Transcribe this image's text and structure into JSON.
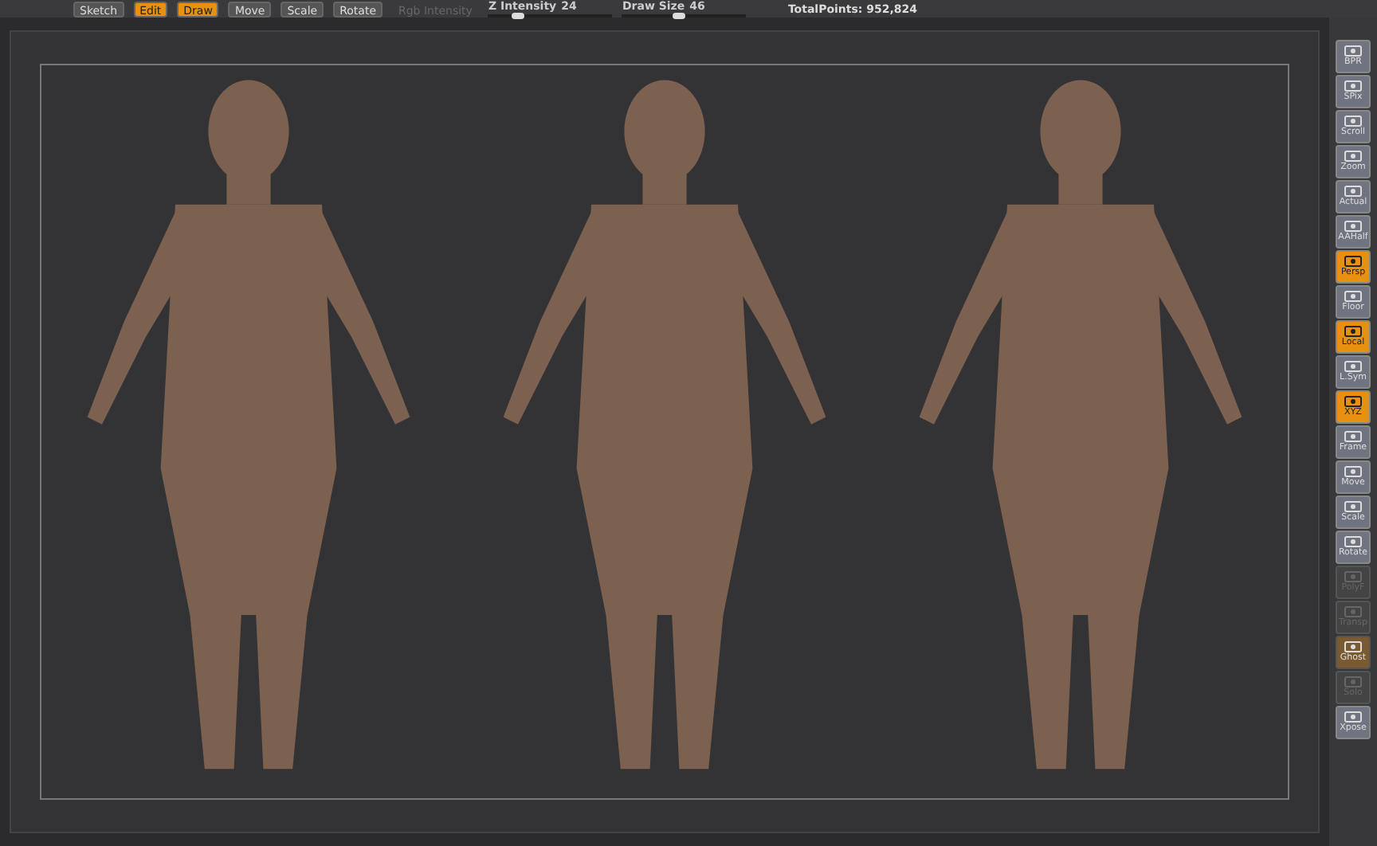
{
  "top_bar": {
    "buttons": [
      {
        "label": "Sketch",
        "selected": false,
        "disabled": false
      },
      {
        "label": "Edit",
        "selected": true,
        "disabled": false
      },
      {
        "label": "Draw",
        "selected": true,
        "disabled": false
      },
      {
        "label": "Move",
        "selected": false,
        "disabled": false
      },
      {
        "label": "Scale",
        "selected": false,
        "disabled": false
      },
      {
        "label": "Rotate",
        "selected": false,
        "disabled": false
      },
      {
        "label": "Rgb Intensity",
        "selected": false,
        "disabled": true
      }
    ],
    "sliders": [
      {
        "label": "Z Intensity",
        "reading": "24",
        "level": 0.24
      },
      {
        "label": "Draw Size",
        "reading": "46",
        "level": 0.46
      }
    ],
    "total_points": "TotalPoints: 952,824"
  },
  "right_toolbar": [
    {
      "label": "BPR",
      "on": false,
      "disabled": false
    },
    {
      "label": "SPix",
      "on": false,
      "disabled": false
    },
    {
      "label": "Scroll",
      "on": false,
      "disabled": false
    },
    {
      "label": "Zoom",
      "on": false,
      "disabled": false
    },
    {
      "label": "Actual",
      "on": false,
      "disabled": false
    },
    {
      "label": "AAHalf",
      "on": false,
      "disabled": false
    },
    {
      "label": "Persp",
      "on": true,
      "disabled": false
    },
    {
      "label": "Floor",
      "on": false,
      "disabled": false
    },
    {
      "label": "Local",
      "on": true,
      "disabled": false
    },
    {
      "label": "L.Sym",
      "on": false,
      "disabled": false
    },
    {
      "label": "XYZ",
      "on": true,
      "disabled": false
    },
    {
      "label": "Frame",
      "on": false,
      "disabled": false
    },
    {
      "label": "Move",
      "on": false,
      "disabled": false
    },
    {
      "label": "Scale",
      "on": false,
      "disabled": false
    },
    {
      "label": "Rotate",
      "on": false,
      "disabled": false
    },
    {
      "label": "PolyF",
      "on": false,
      "disabled": true
    },
    {
      "label": "Transp",
      "on": false,
      "disabled": true
    },
    {
      "label": "Ghost",
      "on": true,
      "disabled": true
    },
    {
      "label": "Solo",
      "on": false,
      "disabled": true
    },
    {
      "label": "Xpose",
      "on": false,
      "disabled": false
    }
  ]
}
